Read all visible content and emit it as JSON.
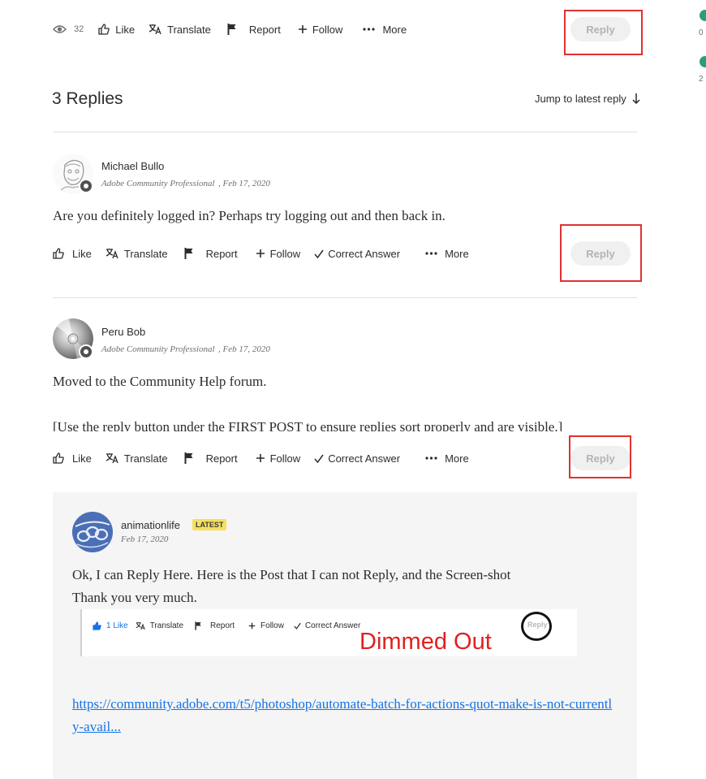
{
  "top_bar": {
    "views": "32",
    "like": "Like",
    "translate": "Translate",
    "report": "Report",
    "follow": "Follow",
    "more": "More",
    "reply": "Reply"
  },
  "right_edge": {
    "count_a": "0",
    "count_b": "2"
  },
  "replies_header": {
    "title": "3 Replies",
    "jump": "Jump to latest reply"
  },
  "replies": [
    {
      "author": "Michael Bullo",
      "role": "Adobe Community Professional",
      "date": ", Feb 17, 2020",
      "body": [
        "Are you definitely logged in? Perhaps try logging out and then back in."
      ],
      "actions": {
        "like": "Like",
        "translate": "Translate",
        "report": "Report",
        "follow": "Follow",
        "correct": "Correct Answer",
        "more": "More",
        "reply": "Reply"
      }
    },
    {
      "author": "Peru Bob",
      "role": "Adobe Community Professional",
      "date": ", Feb 17, 2020",
      "body": [
        "Moved to the Community Help forum.",
        "[Use the reply button under the FIRST POST to ensure replies sort properly and are visible.]"
      ],
      "actions": {
        "like": "Like",
        "translate": "Translate",
        "report": "Report",
        "follow": "Follow",
        "correct": "Correct Answer",
        "more": "More",
        "reply": "Reply"
      }
    }
  ],
  "nested_reply": {
    "author": "animationlife",
    "badge": "LATEST",
    "date": "Feb 17, 2020",
    "body": [
      "Ok, I can Reply Here. Here is the Post that I can not Reply, and the Screen-shot",
      "Thank you very much."
    ],
    "screenshot": {
      "like": "1 Like",
      "translate": "Translate",
      "report": "Report",
      "follow": "Follow",
      "correct": "Correct Answer",
      "reply": "Reply",
      "annotation": "Dimmed Out"
    },
    "link": "https://community.adobe.com/t5/photoshop/automate-batch-for-actions-quot-make-is-not-currently-avail..."
  },
  "colors": {
    "accent_red": "#e03131",
    "link_blue": "#1473e6",
    "badge_yellow": "#f6e05e",
    "green_check": "#2d9d78"
  }
}
